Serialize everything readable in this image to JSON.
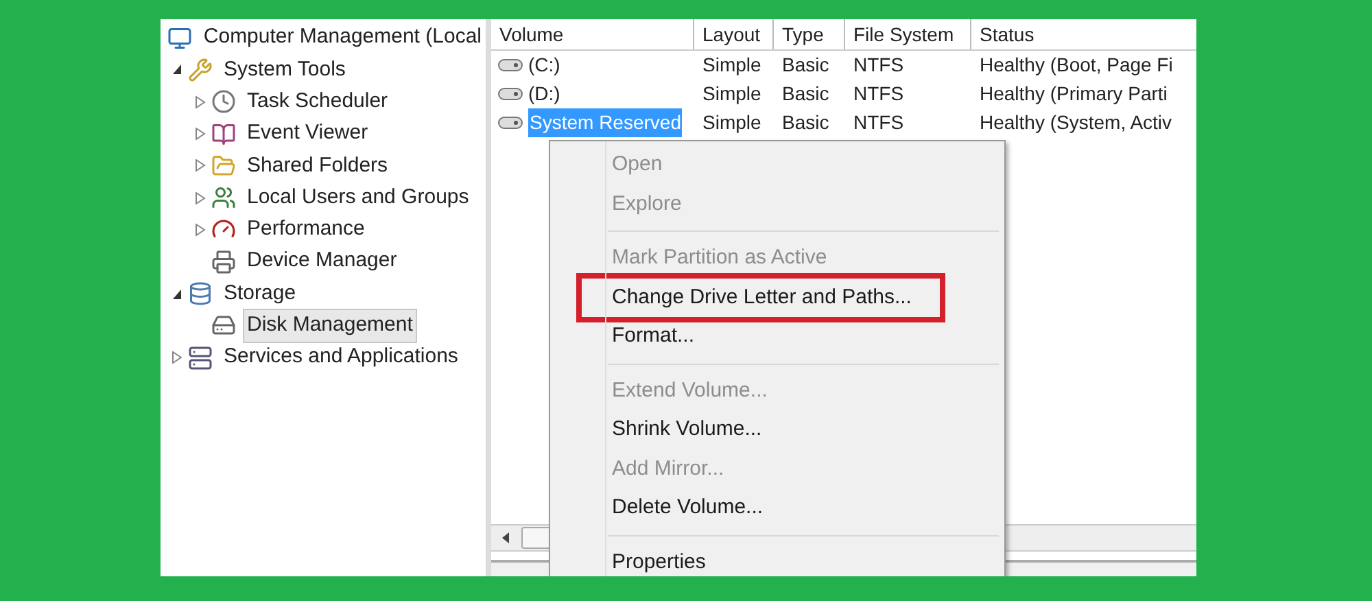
{
  "tree": [
    {
      "label": "Computer Management (Local",
      "selected": false,
      "children": [
        {
          "label": "System Tools",
          "expanded": true,
          "selected": false,
          "children": [
            {
              "label": "Task Scheduler",
              "expanded": false,
              "selected": false
            },
            {
              "label": "Event Viewer",
              "expanded": false,
              "selected": false
            },
            {
              "label": "Shared Folders",
              "expanded": false,
              "selected": false
            },
            {
              "label": "Local Users and Groups",
              "expanded": false,
              "selected": false
            },
            {
              "label": "Performance",
              "expanded": false,
              "selected": false
            },
            {
              "label": "Device Manager",
              "selected": false
            }
          ]
        },
        {
          "label": "Storage",
          "expanded": true,
          "selected": false,
          "children": [
            {
              "label": "Disk Management",
              "selected": true
            }
          ]
        },
        {
          "label": "Services and Applications",
          "expanded": false,
          "selected": false
        }
      ]
    }
  ],
  "table": {
    "columns": [
      "Volume",
      "Layout",
      "Type",
      "File System",
      "Status"
    ],
    "rows": [
      {
        "cells": [
          "(C:)",
          "Simple",
          "Basic",
          "NTFS",
          "Healthy (Boot, Page Fi"
        ],
        "selected": false
      },
      {
        "cells": [
          "(D:)",
          "Simple",
          "Basic",
          "NTFS",
          "Healthy (Primary Parti"
        ],
        "selected": false
      },
      {
        "cells": [
          "System Reserved",
          "Simple",
          "Basic",
          "NTFS",
          "Healthy (System, Activ"
        ],
        "selected": true
      }
    ]
  },
  "context_menu": [
    {
      "kind": "item",
      "label": "Open",
      "disabled": true,
      "highlighted": false
    },
    {
      "kind": "item",
      "label": "Explore",
      "disabled": true,
      "highlighted": false
    },
    {
      "kind": "separator"
    },
    {
      "kind": "item",
      "label": "Mark Partition as Active",
      "disabled": true,
      "highlighted": false
    },
    {
      "kind": "item",
      "label": "Change Drive Letter and Paths...",
      "disabled": false,
      "highlighted": true
    },
    {
      "kind": "item",
      "label": "Format...",
      "disabled": false,
      "highlighted": false
    },
    {
      "kind": "separator"
    },
    {
      "kind": "item",
      "label": "Extend Volume...",
      "disabled": true,
      "highlighted": false
    },
    {
      "kind": "item",
      "label": "Shrink Volume...",
      "disabled": false,
      "highlighted": false
    },
    {
      "kind": "item",
      "label": "Add Mirror...",
      "disabled": true,
      "highlighted": false
    },
    {
      "kind": "item",
      "label": "Delete Volume...",
      "disabled": false,
      "highlighted": false
    },
    {
      "kind": "separator"
    },
    {
      "kind": "item",
      "label": "Properties",
      "disabled": false,
      "highlighted": false
    }
  ]
}
